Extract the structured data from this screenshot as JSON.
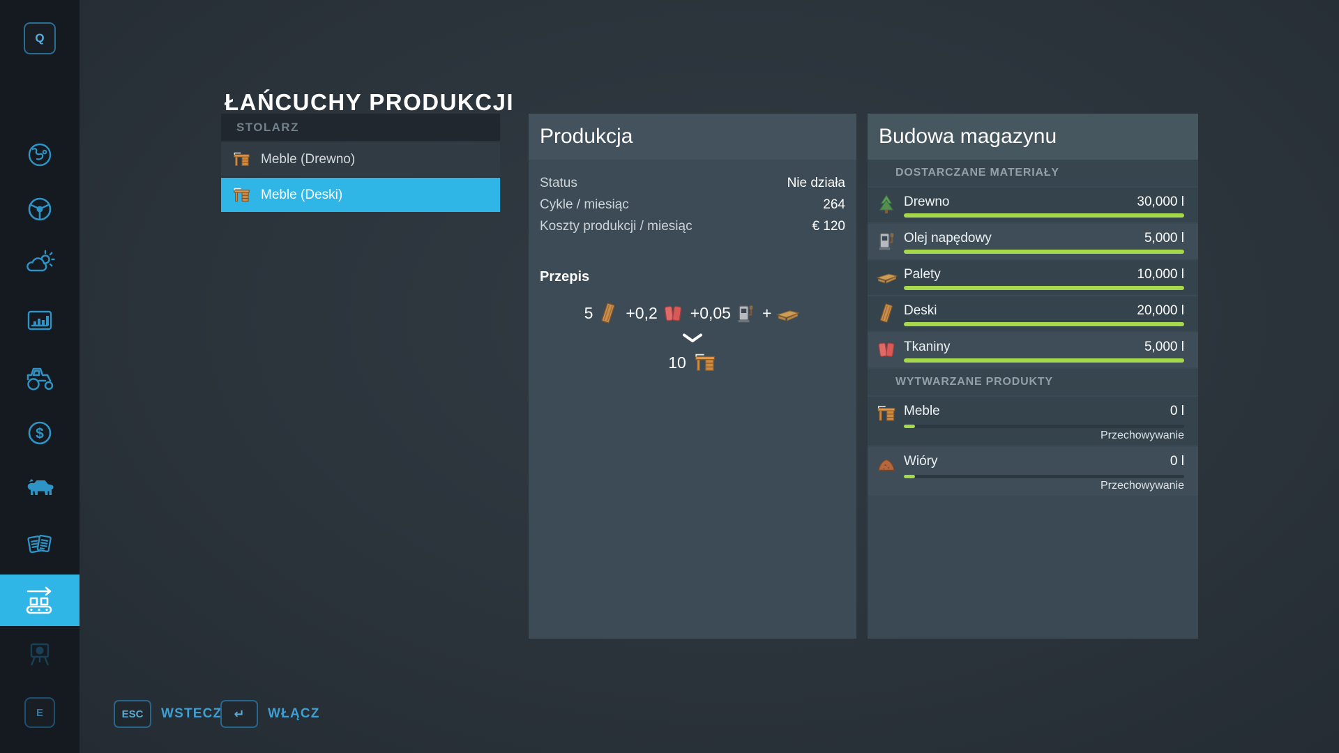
{
  "page_title": "ŁAŃCUCHY PRODUKCJI",
  "colors": {
    "accent_cyan": "#2fb5e6",
    "bar_green": "#a6d84b",
    "panel_background": "#3c4b55",
    "sidebar_background": "#141a20"
  },
  "sidebar": {
    "top_key": "Q",
    "bottom_key": "E",
    "items": [
      {
        "icon": "globe-icon",
        "active": false
      },
      {
        "icon": "steering-wheel-icon",
        "active": false
      },
      {
        "icon": "weather-icon",
        "active": false
      },
      {
        "icon": "statistics-icon",
        "active": false
      },
      {
        "icon": "tractor-icon",
        "active": false
      },
      {
        "icon": "finances-icon",
        "active": false
      },
      {
        "icon": "animals-icon",
        "active": false
      },
      {
        "icon": "contracts-icon",
        "active": false
      },
      {
        "icon": "production-chains-icon",
        "active": true
      },
      {
        "icon": "presentation-icon",
        "active": false
      }
    ]
  },
  "list": {
    "header": "STOLARZ",
    "items": [
      {
        "label": "Meble (Drewno)",
        "icon": "furniture-icon",
        "selected": false
      },
      {
        "label": "Meble (Deski)",
        "icon": "furniture-icon",
        "selected": true
      }
    ]
  },
  "production": {
    "title": "Produkcja",
    "stats": [
      {
        "label": "Status",
        "value": "Nie działa"
      },
      {
        "label": "Cykle / miesiąc",
        "value": "264"
      },
      {
        "label": "Koszty produkcji / miesiąc",
        "value": "€ 120"
      }
    ],
    "recipe": {
      "heading": "Przepis",
      "inputs": [
        {
          "qty": "5",
          "icon": "boards-icon"
        },
        {
          "qty": "+0,2",
          "icon": "fabric-icon"
        },
        {
          "qty": "+0,05",
          "icon": "diesel-icon"
        },
        {
          "qty": "+",
          "icon": "pallet-icon"
        }
      ],
      "output": {
        "qty": "10",
        "icon": "furniture-icon"
      }
    }
  },
  "storage": {
    "title": "Budowa magazynu",
    "materials_header": "DOSTARCZANE MATERIAŁY",
    "materials": [
      {
        "name": "Drewno",
        "amount": "30,000 l",
        "icon": "tree-icon",
        "fill_percent": 100
      },
      {
        "name": "Olej napędowy",
        "amount": "5,000 l",
        "icon": "diesel-icon",
        "fill_percent": 100
      },
      {
        "name": "Palety",
        "amount": "10,000 l",
        "icon": "pallet-icon",
        "fill_percent": 100
      },
      {
        "name": "Deski",
        "amount": "20,000 l",
        "icon": "boards-icon",
        "fill_percent": 100
      },
      {
        "name": "Tkaniny",
        "amount": "5,000 l",
        "icon": "fabric-icon",
        "fill_percent": 100
      }
    ],
    "products_header": "WYTWARZANE PRODUKTY",
    "products": [
      {
        "name": "Meble",
        "amount": "0 l",
        "icon": "furniture-icon",
        "fill_percent": 2,
        "note": "Przechowywanie"
      },
      {
        "name": "Wióry",
        "amount": "0 l",
        "icon": "woodchips-icon",
        "fill_percent": 2,
        "note": "Przechowywanie"
      }
    ]
  },
  "footer": {
    "back_key": "ESC",
    "back_label": "WSTECZ",
    "activate_key": "↵",
    "activate_label": "WŁĄCZ"
  }
}
